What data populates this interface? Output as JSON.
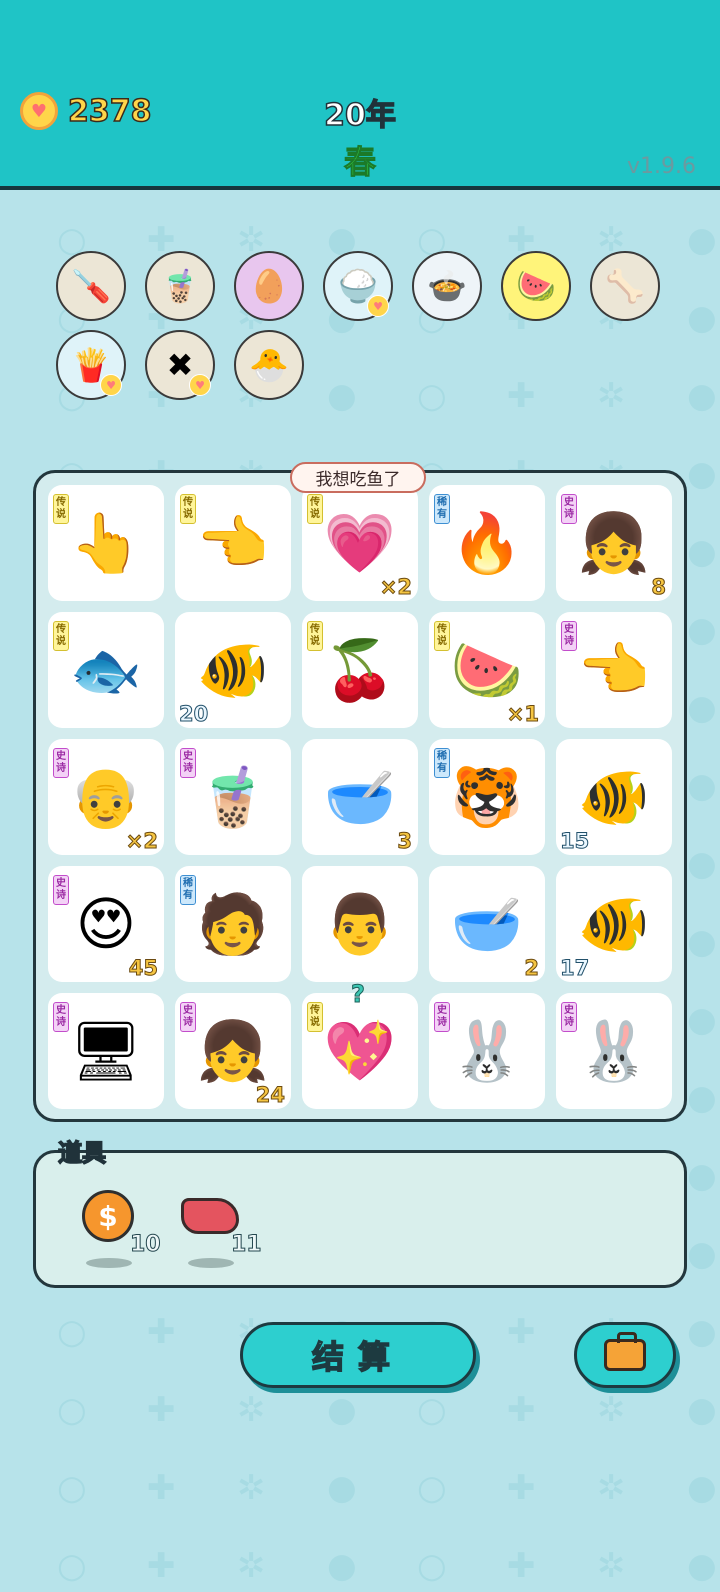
{
  "header": {
    "coins": "2378",
    "year": "20年",
    "season": "春",
    "version": "v1.9.6"
  },
  "colors": {
    "header_bg": "#1fc4c6",
    "page_bg": "#b7e3ea",
    "coin_text": "#ffd54a",
    "season_text": "#39d94a",
    "legend_tag": "#fff59a",
    "epic_tag": "#f3d2f6",
    "rare_tag": "#cde8fb",
    "button": "#2dcfcf"
  },
  "items_bar": [
    {
      "icon": "screwdriver-icon",
      "glyph": "🪛",
      "badge": false
    },
    {
      "icon": "bubble-tea-icon",
      "glyph": "🧋",
      "badge": false
    },
    {
      "icon": "egg-icon",
      "glyph": "🥚",
      "badge": false
    },
    {
      "icon": "rice-bowl-icon",
      "glyph": "🍚",
      "badge": true
    },
    {
      "icon": "pot-icon",
      "glyph": "🍲",
      "badge": false
    },
    {
      "icon": "fruit-basket-icon",
      "glyph": "🍉",
      "badge": false
    },
    {
      "icon": "pet-food-icon",
      "glyph": "🦴",
      "badge": false
    },
    {
      "icon": "fries-icon",
      "glyph": "🍟",
      "badge": true
    },
    {
      "icon": "ad-skip-icon",
      "glyph": "✖",
      "badge": true
    },
    {
      "icon": "chick-icon",
      "glyph": "🐣",
      "badge": false
    }
  ],
  "board": {
    "speech": "我想吃鱼了",
    "question_mark": "?",
    "cells": [
      {
        "icon": "golden-hand-icon",
        "glyph": "👆",
        "tag": "传说",
        "tag_type": "legend",
        "count": "",
        "count_pos": ""
      },
      {
        "icon": "pointing-hand-icon",
        "glyph": "👈",
        "tag": "传说",
        "tag_type": "legend",
        "count": "",
        "count_pos": ""
      },
      {
        "icon": "girl-face-heart-icon",
        "glyph": "💗",
        "tag": "传说",
        "tag_type": "legend",
        "count": "×2",
        "count_pos": "br"
      },
      {
        "icon": "fire-gem-icon",
        "glyph": "🔥",
        "tag": "稀有",
        "tag_type": "rare",
        "count": "",
        "count_pos": ""
      },
      {
        "icon": "braided-girl-icon",
        "glyph": "👧",
        "tag": "史诗",
        "tag_type": "epic",
        "count": "8",
        "count_pos": "br"
      },
      {
        "icon": "koi-fish-icon",
        "glyph": "🐟",
        "tag": "传说",
        "tag_type": "legend",
        "count": "",
        "count_pos": ""
      },
      {
        "icon": "goldfish-icon",
        "glyph": "🐠",
        "tag": "",
        "tag_type": "",
        "count": "20",
        "count_pos": "bl"
      },
      {
        "icon": "fruit-pair-icon",
        "glyph": "🍒",
        "tag": "传说",
        "tag_type": "legend",
        "count": "",
        "count_pos": ""
      },
      {
        "icon": "watermelon-x-icon",
        "glyph": "🍉",
        "tag": "传说",
        "tag_type": "legend",
        "count": "×1",
        "count_pos": "br"
      },
      {
        "icon": "grey-hand-icon",
        "glyph": "👈",
        "tag": "史诗",
        "tag_type": "epic",
        "count": "",
        "count_pos": ""
      },
      {
        "icon": "old-man-beard-icon",
        "glyph": "👴",
        "tag": "史诗",
        "tag_type": "epic",
        "count": "×2",
        "count_pos": "br"
      },
      {
        "icon": "bubble-tea-cup-icon",
        "glyph": "🧋",
        "tag": "史诗",
        "tag_type": "epic",
        "count": "",
        "count_pos": ""
      },
      {
        "icon": "soup-bowl-icon",
        "glyph": "🥣",
        "tag": "",
        "tag_type": "",
        "count": "3",
        "count_pos": "br"
      },
      {
        "icon": "tiger-icon",
        "glyph": "🐯",
        "tag": "稀有",
        "tag_type": "rare",
        "count": "",
        "count_pos": ""
      },
      {
        "icon": "goldfish-icon",
        "glyph": "🐠",
        "tag": "",
        "tag_type": "",
        "count": "15",
        "count_pos": "bl"
      },
      {
        "icon": "love-eyes-old-man-icon",
        "glyph": "😍",
        "tag": "史诗",
        "tag_type": "epic",
        "count": "45",
        "count_pos": "br"
      },
      {
        "icon": "bucket-hat-man-icon",
        "glyph": "🧑",
        "tag": "稀有",
        "tag_type": "rare",
        "count": "",
        "count_pos": ""
      },
      {
        "icon": "glasses-old-man-icon",
        "glyph": "👨",
        "tag": "",
        "tag_type": "",
        "count": "",
        "count_pos": ""
      },
      {
        "icon": "soup-bowl-icon",
        "glyph": "🥣",
        "tag": "",
        "tag_type": "",
        "count": "2",
        "count_pos": "br"
      },
      {
        "icon": "goldfish-icon",
        "glyph": "🐠",
        "tag": "",
        "tag_type": "",
        "count": "17",
        "count_pos": "bl"
      },
      {
        "icon": "graphics-card-icon",
        "glyph": "🖥",
        "tag": "史诗",
        "tag_type": "epic",
        "count": "",
        "count_pos": ""
      },
      {
        "icon": "braided-girl-icon",
        "glyph": "👧",
        "tag": "史诗",
        "tag_type": "epic",
        "count": "24",
        "count_pos": "br"
      },
      {
        "icon": "heart-glasses-icon",
        "glyph": "💖",
        "tag": "传说",
        "tag_type": "legend",
        "count": "",
        "count_pos": ""
      },
      {
        "icon": "rabbit-house-icon",
        "glyph": "🐰",
        "tag": "史诗",
        "tag_type": "epic",
        "count": "",
        "count_pos": ""
      },
      {
        "icon": "rabbit-house-icon",
        "glyph": "🐰",
        "tag": "史诗",
        "tag_type": "epic",
        "count": "",
        "count_pos": ""
      }
    ]
  },
  "tools": {
    "title": "道具",
    "items": [
      {
        "icon": "dollar-coin-icon",
        "count": "10"
      },
      {
        "icon": "liver-icon",
        "count": "11"
      }
    ]
  },
  "buttons": {
    "settle": "结算",
    "bag_icon": "briefcase-icon"
  }
}
